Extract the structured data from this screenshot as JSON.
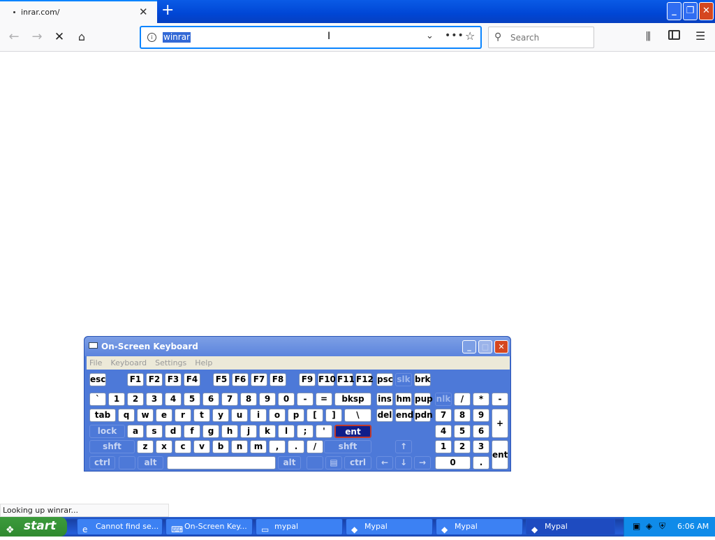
{
  "browser": {
    "tab_title": "inrar.com/",
    "tab_close": "✕",
    "new_tab": "+",
    "url": "winrar",
    "search_placeholder": "Search",
    "status_text": "Looking up winrar..."
  },
  "window_controls": {
    "minimize": "_",
    "restore": "❐",
    "close": "✕"
  },
  "osk": {
    "title": "On-Screen Keyboard",
    "menu": [
      "File",
      "Keyboard",
      "Settings",
      "Help"
    ],
    "keys": [
      {
        "label": "esc"
      },
      {
        "label": "F1"
      },
      {
        "label": "F2"
      },
      {
        "label": "F3"
      },
      {
        "label": "F4"
      },
      {
        "label": "F5"
      },
      {
        "label": "F6"
      },
      {
        "label": "F7"
      },
      {
        "label": "F8"
      },
      {
        "label": "F9"
      },
      {
        "label": "F10"
      },
      {
        "label": "F11"
      },
      {
        "label": "F12"
      },
      {
        "label": "psc"
      },
      {
        "label": "slk"
      },
      {
        "label": "brk"
      },
      {
        "label": "`"
      },
      {
        "label": "1"
      },
      {
        "label": "2"
      },
      {
        "label": "3"
      },
      {
        "label": "4"
      },
      {
        "label": "5"
      },
      {
        "label": "6"
      },
      {
        "label": "7"
      },
      {
        "label": "8"
      },
      {
        "label": "9"
      },
      {
        "label": "0"
      },
      {
        "label": "-"
      },
      {
        "label": "="
      },
      {
        "label": "bksp"
      },
      {
        "label": "ins"
      },
      {
        "label": "hm"
      },
      {
        "label": "pup"
      },
      {
        "label": "nlk"
      },
      {
        "label": "/"
      },
      {
        "label": "*"
      },
      {
        "label": "-"
      },
      {
        "label": "tab"
      },
      {
        "label": "q"
      },
      {
        "label": "w"
      },
      {
        "label": "e"
      },
      {
        "label": "r"
      },
      {
        "label": "t"
      },
      {
        "label": "y"
      },
      {
        "label": "u"
      },
      {
        "label": "i"
      },
      {
        "label": "o"
      },
      {
        "label": "p"
      },
      {
        "label": "["
      },
      {
        "label": "]"
      },
      {
        "label": "\\"
      },
      {
        "label": "del"
      },
      {
        "label": "end"
      },
      {
        "label": "pdn"
      },
      {
        "label": "7"
      },
      {
        "label": "8"
      },
      {
        "label": "9"
      },
      {
        "label": "+"
      },
      {
        "label": "lock"
      },
      {
        "label": "a"
      },
      {
        "label": "s"
      },
      {
        "label": "d"
      },
      {
        "label": "f"
      },
      {
        "label": "g"
      },
      {
        "label": "h"
      },
      {
        "label": "j"
      },
      {
        "label": "k"
      },
      {
        "label": "l"
      },
      {
        "label": ";"
      },
      {
        "label": "'"
      },
      {
        "label": "ent"
      },
      {
        "label": "4"
      },
      {
        "label": "5"
      },
      {
        "label": "6"
      },
      {
        "label": "shft"
      },
      {
        "label": "z"
      },
      {
        "label": "x"
      },
      {
        "label": "c"
      },
      {
        "label": "v"
      },
      {
        "label": "b"
      },
      {
        "label": "n"
      },
      {
        "label": "m"
      },
      {
        "label": ","
      },
      {
        "label": "."
      },
      {
        "label": "/"
      },
      {
        "label": "shft"
      },
      {
        "label": "↑"
      },
      {
        "label": "1"
      },
      {
        "label": "2"
      },
      {
        "label": "3"
      },
      {
        "label": "ent"
      },
      {
        "label": "ctrl"
      },
      {
        "label": ""
      },
      {
        "label": "alt"
      },
      {
        "label": ""
      },
      {
        "label": "alt"
      },
      {
        "label": ""
      },
      {
        "label": "▤"
      },
      {
        "label": "ctrl"
      },
      {
        "label": "←"
      },
      {
        "label": "↓"
      },
      {
        "label": "→"
      },
      {
        "label": "0"
      },
      {
        "label": "."
      }
    ]
  },
  "taskbar": {
    "start_label": "start",
    "tasks": [
      {
        "label": "Cannot find se...",
        "icon": "ie-icon"
      },
      {
        "label": "On-Screen Key...",
        "icon": "keyboard-icon"
      },
      {
        "label": "mypal",
        "icon": "folder-icon"
      },
      {
        "label": "Mypal",
        "icon": "mypal-icon"
      },
      {
        "label": "Mypal",
        "icon": "mypal-icon"
      },
      {
        "label": "Mypal",
        "icon": "mypal-icon"
      }
    ],
    "clock": "6:06 AM"
  }
}
